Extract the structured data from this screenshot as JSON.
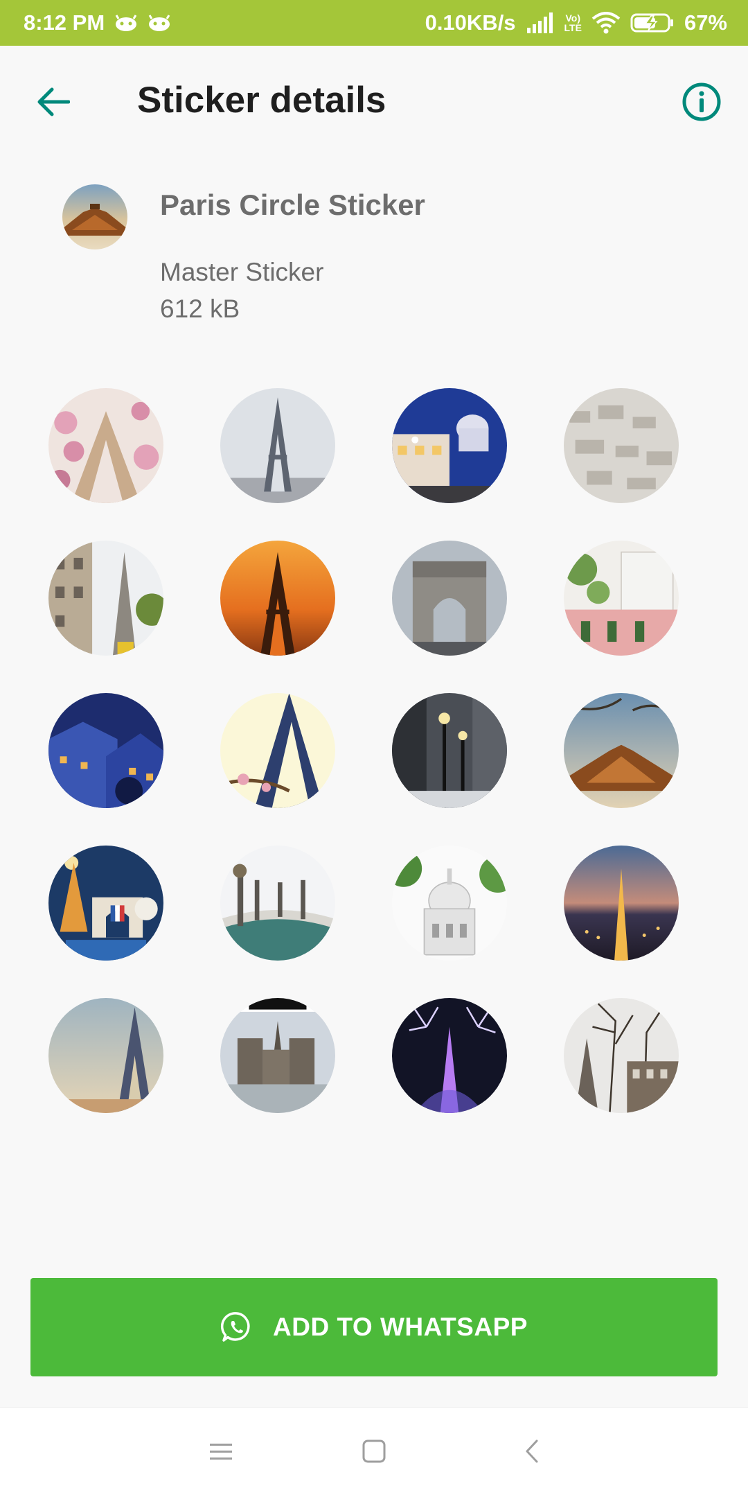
{
  "status_bar": {
    "time": "8:12 PM",
    "network_speed": "0.10KB/s",
    "volte_label_top": "Vo)",
    "volte_label_bottom": "LTE",
    "battery_percent": "67%",
    "icons": [
      "android-notification-icon",
      "android-notification-icon",
      "signal-icon",
      "volte-icon",
      "wifi-icon",
      "battery-charging-icon"
    ]
  },
  "app_bar": {
    "title": "Sticker details",
    "back_icon": "arrow-left-icon",
    "info_icon": "info-icon",
    "accent_color": "#00897b"
  },
  "pack": {
    "name": "Paris Circle Sticker",
    "publisher": "Master Sticker",
    "size": "612 kB"
  },
  "stickers": [
    {
      "subject": "eiffel-tower-blossoms"
    },
    {
      "subject": "eiffel-tower-skyline"
    },
    {
      "subject": "montmartre-street-night"
    },
    {
      "subject": "paris-rooftops"
    },
    {
      "subject": "eiffel-tower-street"
    },
    {
      "subject": "eiffel-tower-sunset"
    },
    {
      "subject": "arc-de-triomphe"
    },
    {
      "subject": "pink-cafe-building"
    },
    {
      "subject": "blue-rooftops-night"
    },
    {
      "subject": "eiffel-tower-low-angle"
    },
    {
      "subject": "street-lamps-winter"
    },
    {
      "subject": "eiffel-tower-below-branches"
    },
    {
      "subject": "paris-illustration"
    },
    {
      "subject": "pont-alexandre-iii"
    },
    {
      "subject": "sacre-coeur"
    },
    {
      "subject": "eiffel-tower-night-city"
    },
    {
      "subject": "eiffel-tower-dusk"
    },
    {
      "subject": "notre-dame"
    },
    {
      "subject": "eiffel-tower-fireworks"
    },
    {
      "subject": "eiffel-tower-trees"
    }
  ],
  "add_button": {
    "label": "ADD TO WHATSAPP",
    "icon": "whatsapp-icon",
    "color": "#4cba3a"
  },
  "nav_bar": {
    "icons": [
      "menu-icon",
      "home-icon",
      "back-icon"
    ]
  }
}
